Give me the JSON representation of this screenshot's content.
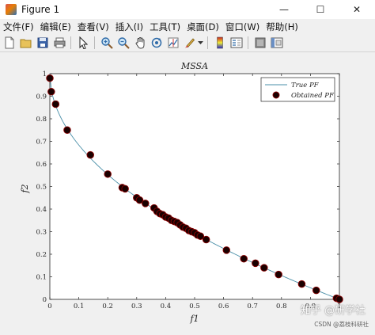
{
  "window": {
    "title": "Figure 1",
    "minimize": "—",
    "maximize": "☐",
    "close": "✕"
  },
  "menu": [
    "文件(F)",
    "编辑(E)",
    "查看(V)",
    "插入(I)",
    "工具(T)",
    "桌面(D)",
    "窗口(W)",
    "帮助(H)"
  ],
  "toolbar_icons": [
    "new-figure-icon",
    "open-file-icon",
    "save-icon",
    "print-icon",
    "pointer-icon",
    "zoom-in-icon",
    "zoom-out-icon",
    "pan-icon",
    "rotate-3d-icon",
    "data-cursor-icon",
    "brush-icon",
    "colorbar-icon",
    "legend-icon",
    "hide-plot-tools-icon",
    "show-plot-tools-icon"
  ],
  "watermark": {
    "main": "知乎 @研学社",
    "sub": "CSDN @荔枝科研社"
  },
  "colors": {
    "true_pf_line": "#4a8fa8",
    "obtained_pf_face": "#1a0000",
    "obtained_pf_edge": "#8b0000"
  },
  "chart_data": {
    "type": "scatter",
    "title": "MSSA",
    "xlabel": "f1",
    "ylabel": "f2",
    "xlim": [
      0,
      1
    ],
    "ylim": [
      0,
      1
    ],
    "xticks": [
      "0",
      "0.1",
      "0.2",
      "0.3",
      "0.4",
      "0.5",
      "0.6",
      "0.7",
      "0.8",
      "0.9",
      "1"
    ],
    "yticks": [
      "0",
      "0.1",
      "0.2",
      "0.3",
      "0.4",
      "0.5",
      "0.6",
      "0.7",
      "0.8",
      "0.9",
      "1"
    ],
    "legend_position": "top-right",
    "series": [
      {
        "name": "True PF",
        "style": "line",
        "function": "1 - sqrt(f1)"
      },
      {
        "name": "Obtained PF",
        "style": "markers",
        "points": [
          [
            0.0,
            0.98
          ],
          [
            0.005,
            0.92
          ],
          [
            0.02,
            0.865
          ],
          [
            0.06,
            0.75
          ],
          [
            0.14,
            0.64
          ],
          [
            0.2,
            0.555
          ],
          [
            0.25,
            0.495
          ],
          [
            0.26,
            0.49
          ],
          [
            0.3,
            0.45
          ],
          [
            0.31,
            0.44
          ],
          [
            0.33,
            0.425
          ],
          [
            0.36,
            0.405
          ],
          [
            0.37,
            0.39
          ],
          [
            0.38,
            0.38
          ],
          [
            0.39,
            0.375
          ],
          [
            0.4,
            0.365
          ],
          [
            0.41,
            0.36
          ],
          [
            0.42,
            0.35
          ],
          [
            0.43,
            0.345
          ],
          [
            0.44,
            0.34
          ],
          [
            0.45,
            0.33
          ],
          [
            0.46,
            0.32
          ],
          [
            0.47,
            0.315
          ],
          [
            0.48,
            0.305
          ],
          [
            0.49,
            0.3
          ],
          [
            0.5,
            0.295
          ],
          [
            0.51,
            0.285
          ],
          [
            0.52,
            0.28
          ],
          [
            0.54,
            0.265
          ],
          [
            0.61,
            0.218
          ],
          [
            0.67,
            0.18
          ],
          [
            0.71,
            0.16
          ],
          [
            0.74,
            0.14
          ],
          [
            0.79,
            0.11
          ],
          [
            0.87,
            0.068
          ],
          [
            0.92,
            0.04
          ],
          [
            0.99,
            0.005
          ],
          [
            1.0,
            0.0
          ]
        ]
      }
    ]
  }
}
